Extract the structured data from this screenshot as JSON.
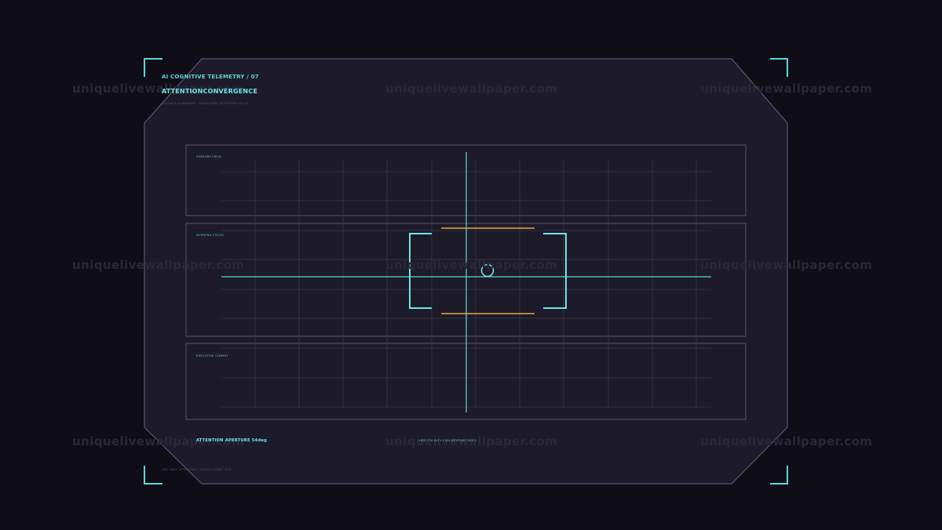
{
  "header": {
    "kicker": "AI COGNITIVE TELEMETRY / 07",
    "title": "ATTENTIONCONVERGENCE",
    "subtitle": "SALIENCE ALIGNMENT · SIGNATURAL ATTENTION FOCUS"
  },
  "lanes": [
    {
      "label": "SENSORY FIELD"
    },
    {
      "label": "WORKING FOCUS"
    },
    {
      "label": "EXECUTIVE COMMIT"
    }
  ],
  "footer": {
    "aperture": "ATTENTION APERTURE 54deg",
    "readout": "HDG 274   ALT+1 ELV   KEYPOINT SRV 1",
    "footnote": "SYNC BASE LATTICE REAL · SIGNAL LOCKED · 0.97"
  },
  "watermark": "uniquelivewallpaper.com",
  "colors": {
    "background": "#0f0e17",
    "panel": "#1d1a29",
    "panel_border": "#5a5670",
    "accent_cyan": "#5ed6d6",
    "accent_amber": "#e8a93a",
    "grid": "#3a3648"
  }
}
